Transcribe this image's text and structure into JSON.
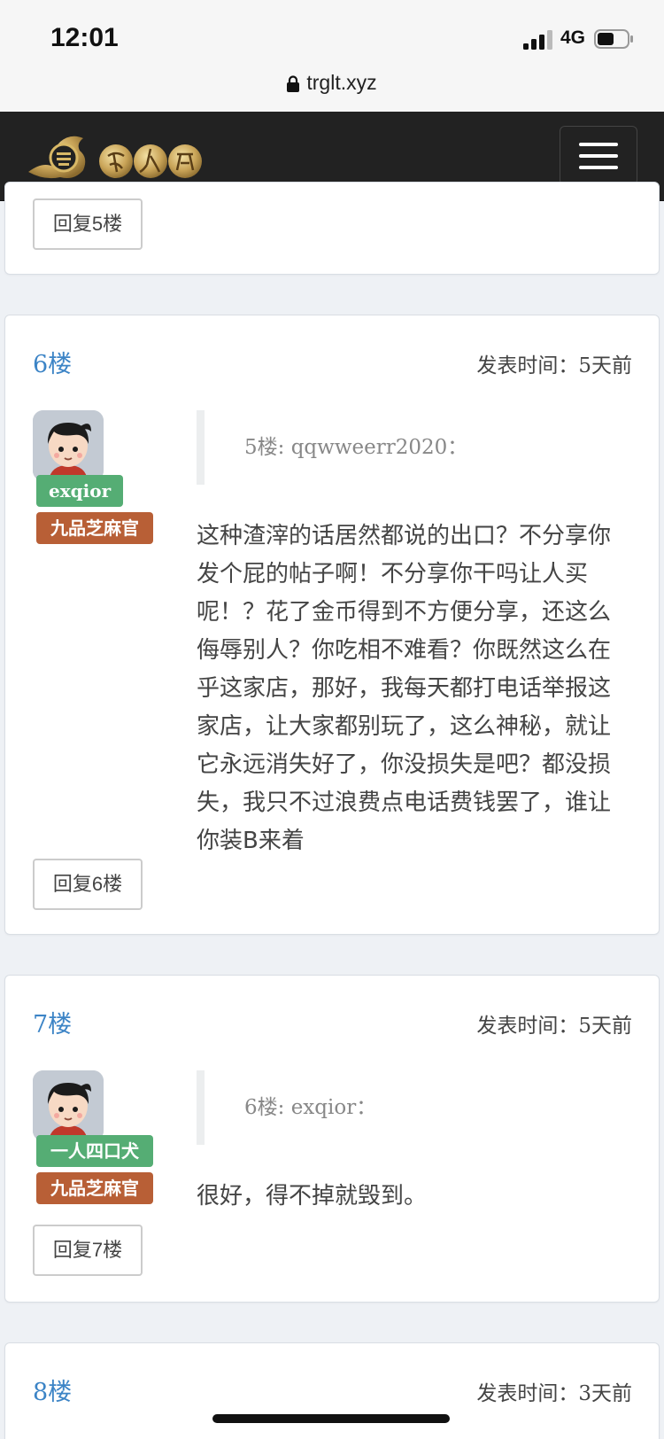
{
  "status_bar": {
    "time": "12:01",
    "network": "4G",
    "signal_icon": "cellular-signal-icon",
    "battery_icon": "battery-icon"
  },
  "browser": {
    "url": "trglt.xyz",
    "lock_icon": "lock-icon"
  },
  "header": {
    "logo_icon": "site-logo-icon",
    "menu_icon": "hamburger-menu-icon"
  },
  "posts": [
    {
      "reply_label": "回复5楼"
    },
    {
      "floor": "6楼",
      "time": "发表时间：5天前",
      "username": "exqior",
      "rank": "九品芝麻官",
      "quote": "5楼: qqwweerr2020：",
      "content": "这种渣滓的话居然都说的出口？不分享你发个屁的帖子啊！不分享你干吗让人买呢！？花了金币得到不方便分享，还这么侮辱别人？你吃相不难看？你既然这么在乎这家店，那好，我每天都打电话举报这家店，让大家都别玩了，这么神秘，就让它永远消失好了，你没损失是吧？都没损失，我只不过浪费点电话费钱罢了，谁让你装B来着",
      "reply_label": "回复6楼"
    },
    {
      "floor": "7楼",
      "time": "发表时间：5天前",
      "username": "一人四口犬",
      "rank": "九品芝麻官",
      "quote": "6楼: exqior：",
      "content": "很好，得不掉就毁到。",
      "reply_label": "回复7楼"
    },
    {
      "floor": "8楼",
      "time": "发表时间：3天前"
    }
  ],
  "colors": {
    "floor": "#3c84c6",
    "name_badge": "#55ad74",
    "rank_badge": "#b85f36",
    "header_bg": "#222222"
  }
}
